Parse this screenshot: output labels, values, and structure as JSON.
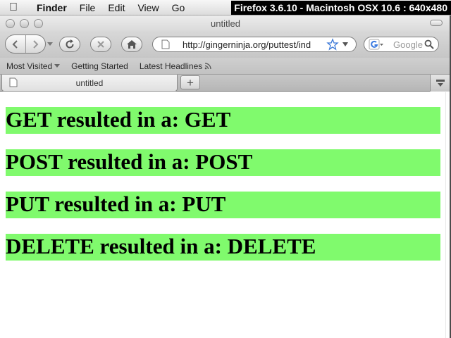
{
  "menubar": {
    "app": "Finder",
    "items": [
      "File",
      "Edit",
      "View",
      "Go"
    ]
  },
  "overlay_title": "Firefox 3.6.10 - Macintosh OSX 10.6 : 640x480",
  "window": {
    "title": "untitled"
  },
  "toolbar": {
    "url": "http://gingerninja.org/puttest/ind",
    "search_placeholder": "Google"
  },
  "bookmarks": {
    "items": [
      "Most Visited",
      "Getting Started",
      "Latest Headlines"
    ]
  },
  "tabs": [
    {
      "label": "untitled"
    }
  ],
  "new_tab_label": "+",
  "results": [
    "GET resulted in a: GET",
    "POST resulted in a: POST",
    "PUT resulted in a: PUT",
    "DELETE resulted in a: DELETE"
  ],
  "colors": {
    "result_background": "#80fa6d",
    "menubar": "#e8e8e8",
    "overlay": "#000000"
  }
}
